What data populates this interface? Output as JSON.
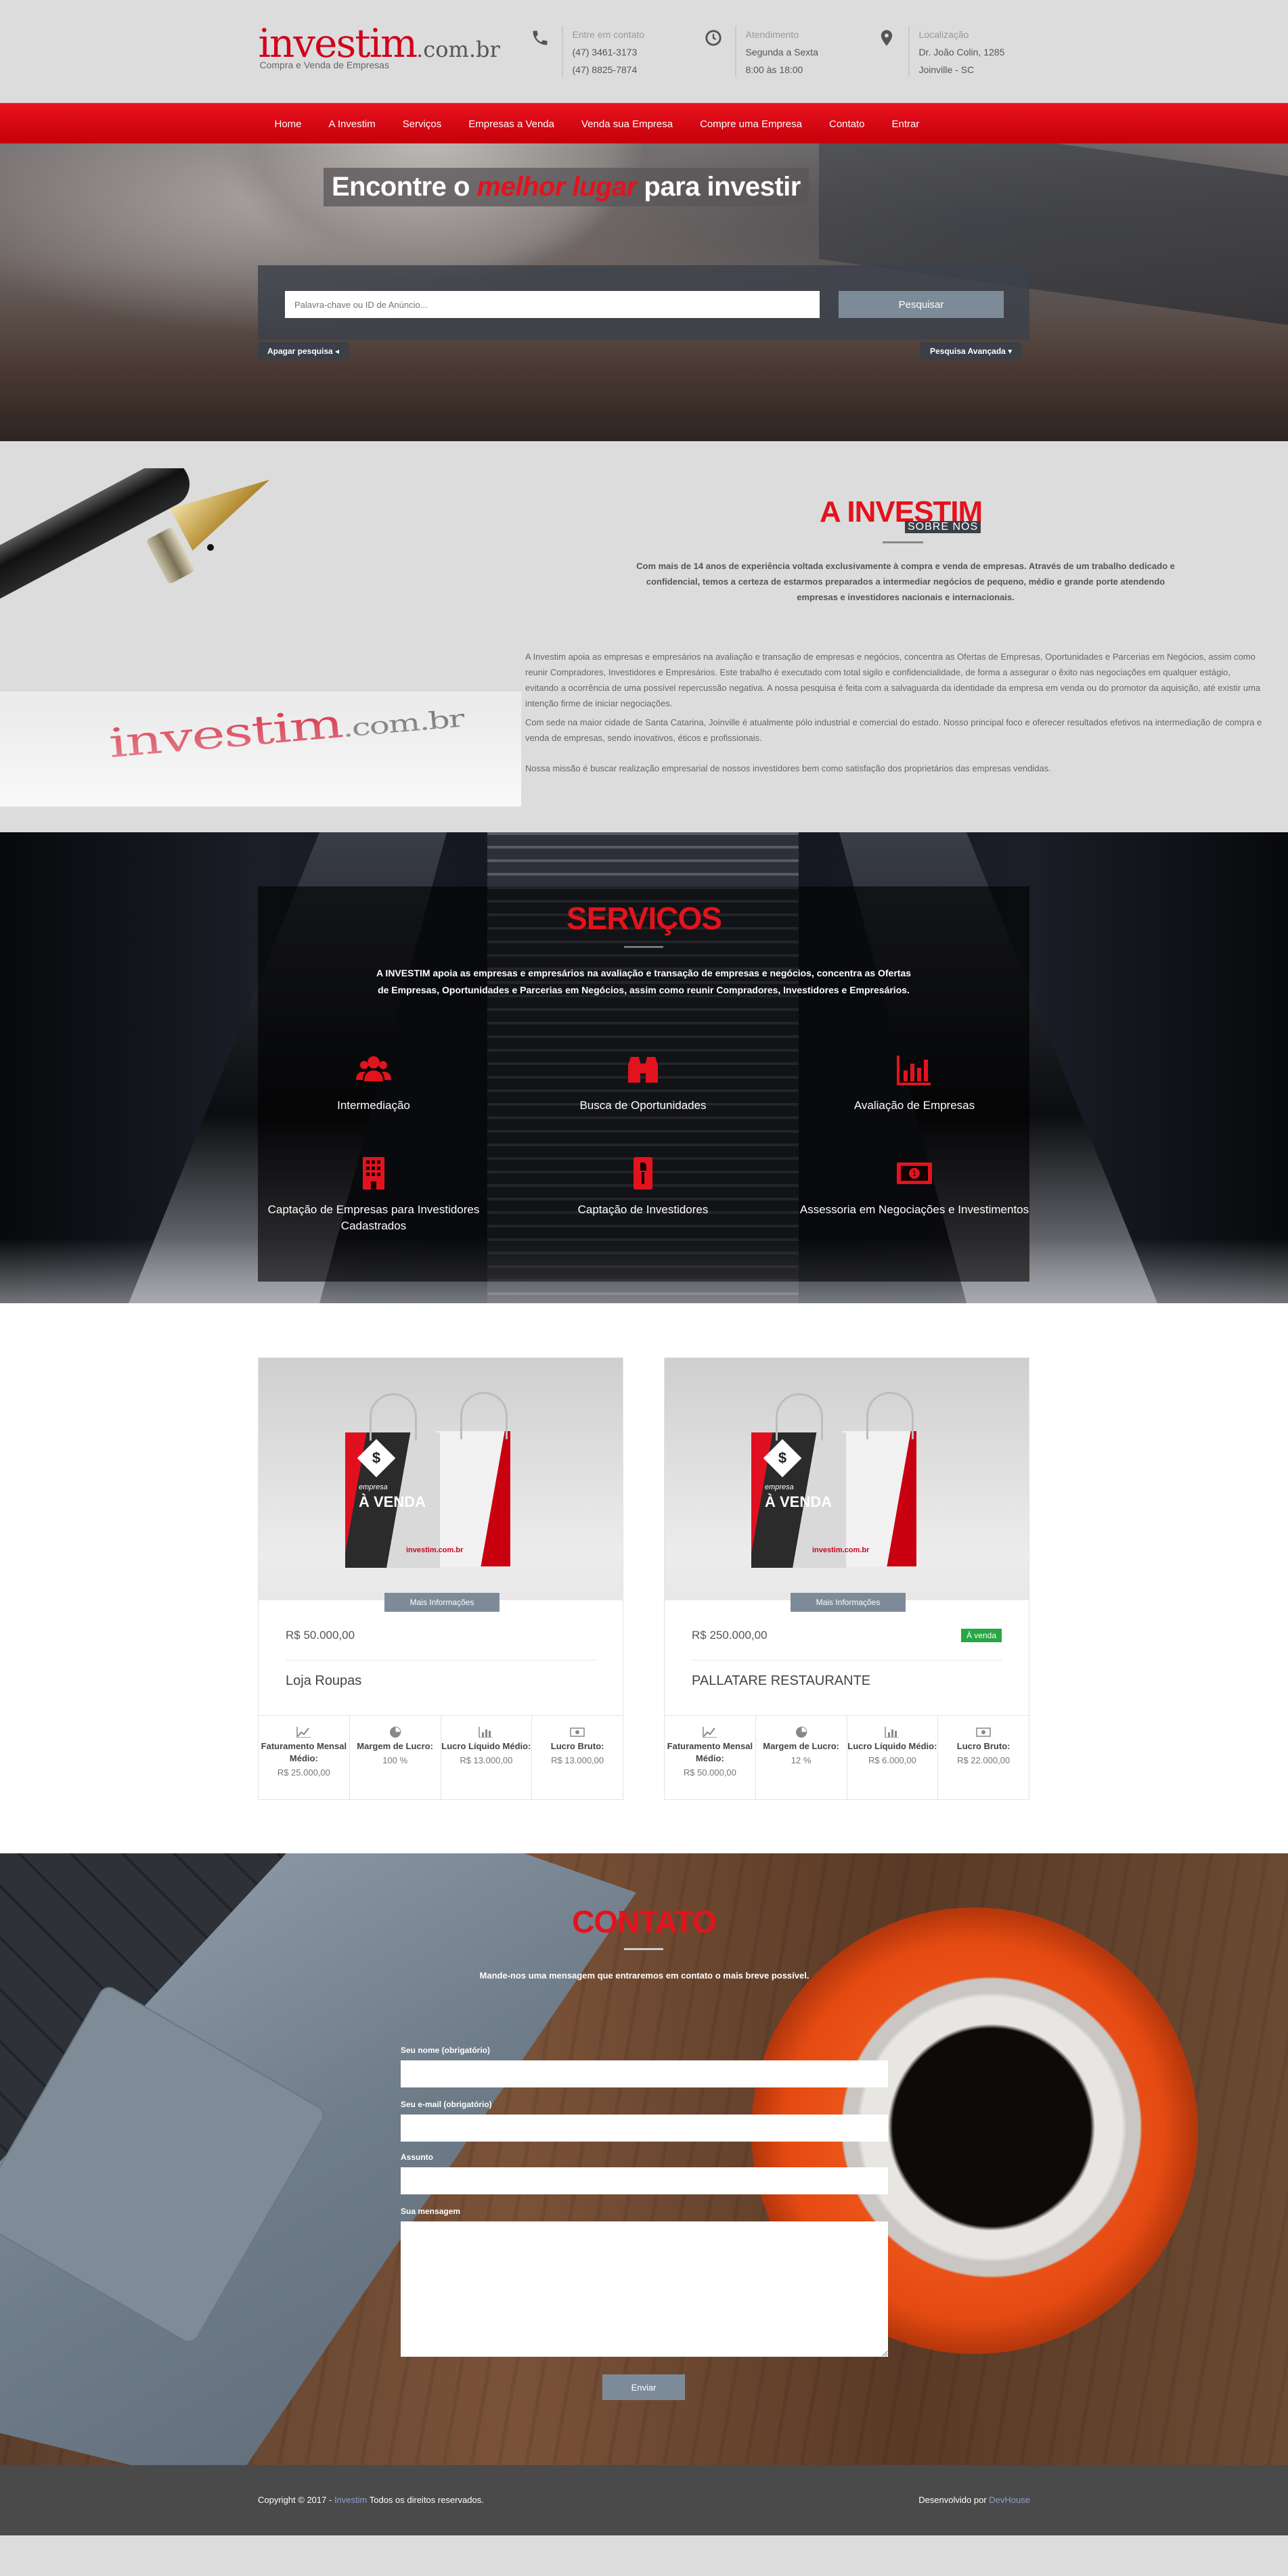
{
  "header": {
    "logo_main": "investim",
    "logo_tld": ".com.br",
    "logo_tagline": "Compra e Venda de Empresas",
    "contact": {
      "label": "Entre em contato",
      "line1": "(47) 3461-3173",
      "line2": "(47) 8825-7874",
      "icon": "phone-icon"
    },
    "hours": {
      "label": "Atendimento",
      "line1": "Segunda a Sexta",
      "line2": "8:00 às 18:00",
      "icon": "clock-icon"
    },
    "location": {
      "label": "Localização",
      "line1": "Dr. João Colin, 1285",
      "line2": "Joinville - SC",
      "icon": "map-pin-icon"
    }
  },
  "nav": {
    "items": [
      "Home",
      "A Investim",
      "Serviços",
      "Empresas a Venda",
      "Venda sua Empresa",
      "Compre uma Empresa",
      "Contato",
      "Entrar"
    ]
  },
  "hero": {
    "title_before": "Encontre o",
    "title_highlight": "melhor lugar",
    "title_after": "para investir",
    "search_placeholder": "Palavra-chave ou ID de Anúncio...",
    "search_button": "Pesquisar",
    "clear_label": "Apagar pesquisa",
    "advanced_label": "Pesquisa Avançada"
  },
  "about": {
    "image_logo": "investim",
    "image_tld": ".com.br",
    "title": "A INVESTIM",
    "subtitle": "SOBRE NÓS",
    "lead": "Com mais de 14 anos de experiência voltada exclusivamente à compra e venda de empresas. Através de um trabalho dedicado e confidencial, temos a certeza de estarmos preparados a intermediar negócios de pequeno, médio e grande porte atendendo empresas e investidores nacionais e internacionais.",
    "p1": "A Investim apoia as empresas e empresários na avaliação e transação de empresas e negócios, concentra as Ofertas de Empresas, Oportunidades e Parcerias em Negócios, assim como reunir Compradores, Investidores e Empresários. Este trabalho é executado com total sigilo e confidencialidade, de forma a assegurar o êxito nas negociações em qualquer estágio, evitando a ocorrência de uma possível repercussão negativa. A nossa pesquisa é feita com a salvaguarda da identidade da empresa em venda ou do promotor da aquisição, até existir uma intenção firme de iniciar negociações.",
    "p2": "Com sede na maior cidade de Santa Catarina, Joinville é atualmente pólo industrial e comercial do estado. Nosso principal foco e oferecer resultados efetivos na intermediação de compra e venda de empresas, sendo inovativos, éticos e profissionais.",
    "p3": "Nossa missão é buscar realização empresarial de nossos investidores bem como satisfação dos proprietários das empresas vendidas."
  },
  "services": {
    "title": "SERVIÇOS",
    "lead": "A INVESTIM apoia as empresas e empresários na avaliação e transação de empresas e negócios, concentra as Ofertas de Empresas, Oportunidades e Parcerias em Negócios, assim como reunir Compradores, Investidores e Empresários.",
    "items": [
      {
        "label": "Intermediação",
        "icon": "users-icon"
      },
      {
        "label": "Busca de Oportunidades",
        "icon": "binoculars-icon"
      },
      {
        "label": "Avaliação de Empresas",
        "icon": "bar-chart-icon"
      },
      {
        "label": "Captação de Empresas para Investidores Cadastrados",
        "icon": "building-icon"
      },
      {
        "label": "Captação de Investidores",
        "icon": "fire-extinguisher-icon"
      },
      {
        "label": "Assessoria em Negociações e Investimentos",
        "icon": "money-icon"
      }
    ]
  },
  "listings": [
    {
      "image_text_small": "empresa",
      "image_text": "À VENDA",
      "image_brand": "investim.com.br",
      "more": "Mais Informações",
      "price": "R$ 50.000,00",
      "badge": "",
      "name": "Loja Roupas",
      "stats": [
        {
          "label": "Faturamento Mensal Médio:",
          "value": "R$ 25.000,00",
          "icon": "line-chart-icon"
        },
        {
          "label": "Margem de Lucro:",
          "value": "100 %",
          "icon": "pie-chart-icon"
        },
        {
          "label": "Lucro Líquido Médio:",
          "value": "R$ 13.000,00",
          "icon": "bar-chart-icon"
        },
        {
          "label": "Lucro Bruto:",
          "value": "R$ 13.000,00",
          "icon": "money-icon"
        }
      ]
    },
    {
      "image_text_small": "empresa",
      "image_text": "À VENDA",
      "image_brand": "investim.com.br",
      "more": "Mais Informações",
      "price": "R$ 250.000,00",
      "badge": "À venda",
      "name": "PALLATARE RESTAURANTE",
      "stats": [
        {
          "label": "Faturamento Mensal Médio:",
          "value": "R$ 50.000,00",
          "icon": "line-chart-icon"
        },
        {
          "label": "Margem de Lucro:",
          "value": "12 %",
          "icon": "pie-chart-icon"
        },
        {
          "label": "Lucro Líquido Médio:",
          "value": "R$ 6.000,00",
          "icon": "bar-chart-icon"
        },
        {
          "label": "Lucro Bruto:",
          "value": "R$ 22.000,00",
          "icon": "money-icon"
        }
      ]
    }
  ],
  "contact": {
    "title": "CONTATO",
    "lead": "Mande-nos uma mensagem que entraremos em contato o mais breve possível.",
    "name_label": "Seu nome (obrigatório)",
    "email_label": "Seu e-mail (obrigatório)",
    "subject_label": "Assunto",
    "message_label": "Sua mensagem",
    "send": "Enviar"
  },
  "footer": {
    "copy_before": "Copyright © 2017 -",
    "copy_link": "Investim",
    "copy_after": "Todos os direitos reservados.",
    "dev_before": "Desenvolvido por",
    "dev_link": "DevHouse"
  },
  "colors": {
    "brand_red": "#e3131d",
    "button_gray": "#7d8b99",
    "badge_green": "#28a745",
    "footer_bg": "#4a4a4a"
  }
}
